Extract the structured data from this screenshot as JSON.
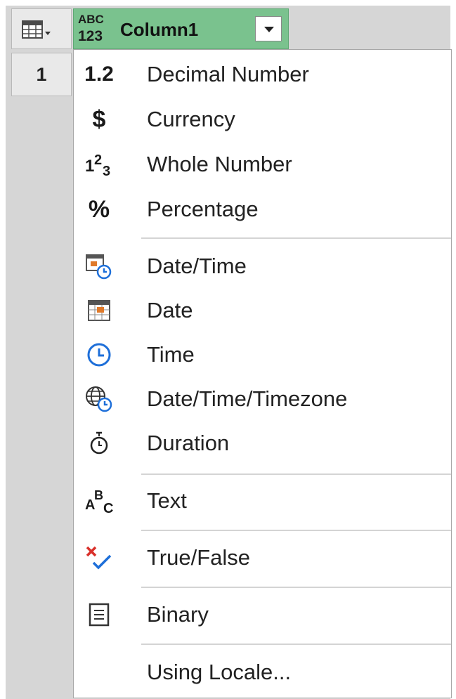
{
  "header": {
    "type_badge_top": "ABC",
    "type_badge_bottom": "123",
    "column_name": "Column1"
  },
  "grid": {
    "row_number": "1"
  },
  "menu": {
    "items": [
      {
        "label": "Decimal Number",
        "icon": "decimal-icon",
        "glyph": "1.2"
      },
      {
        "label": "Currency",
        "icon": "currency-icon",
        "glyph": "$"
      },
      {
        "label": "Whole Number",
        "icon": "whole-number-icon",
        "glyph": "1 2 3"
      },
      {
        "label": "Percentage",
        "icon": "percentage-icon",
        "glyph": "%"
      },
      {
        "label": "Date/Time",
        "icon": "datetime-icon"
      },
      {
        "label": "Date",
        "icon": "date-icon"
      },
      {
        "label": "Time",
        "icon": "time-icon"
      },
      {
        "label": "Date/Time/Timezone",
        "icon": "datetime-timezone-icon"
      },
      {
        "label": "Duration",
        "icon": "duration-icon"
      },
      {
        "label": "Text",
        "icon": "text-icon",
        "glyph": "A B C"
      },
      {
        "label": "True/False",
        "icon": "true-false-icon"
      },
      {
        "label": "Binary",
        "icon": "binary-icon"
      },
      {
        "label": "Using Locale...",
        "icon": ""
      }
    ]
  },
  "colors": {
    "header_green": "#7ac28e",
    "accent_blue": "#1e6fd9",
    "accent_red": "#d9302b",
    "accent_orange": "#e07a2a"
  }
}
